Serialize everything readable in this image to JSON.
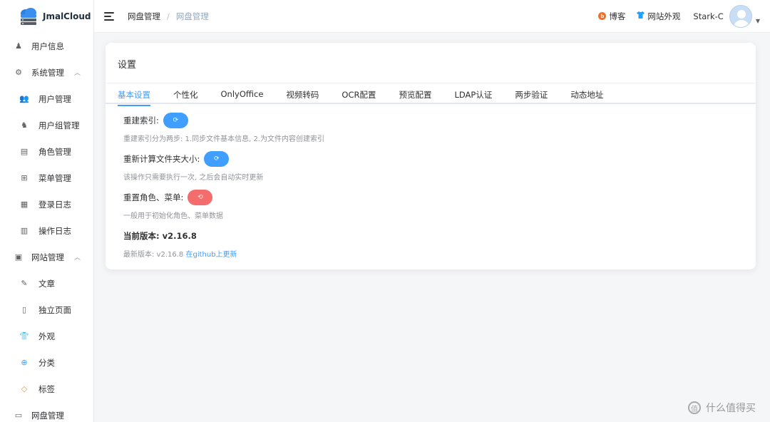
{
  "app": {
    "name": "JmalCloud"
  },
  "sidebar": {
    "items": [
      {
        "label": "用户信息",
        "icon": "user-icon",
        "level": "top"
      },
      {
        "label": "系统管理",
        "icon": "gear-icon",
        "level": "top",
        "expanded": true
      },
      {
        "label": "用户管理",
        "icon": "users-icon",
        "level": "sub"
      },
      {
        "label": "用户组管理",
        "icon": "user-group-icon",
        "level": "sub"
      },
      {
        "label": "角色管理",
        "icon": "id-card-icon",
        "level": "sub"
      },
      {
        "label": "菜单管理",
        "icon": "grid-icon",
        "level": "sub"
      },
      {
        "label": "登录日志",
        "icon": "log-icon",
        "level": "sub"
      },
      {
        "label": "操作日志",
        "icon": "document-icon",
        "level": "sub"
      },
      {
        "label": "网站管理",
        "icon": "monitor-icon",
        "level": "top",
        "expanded": true
      },
      {
        "label": "文章",
        "icon": "article-icon",
        "level": "sub"
      },
      {
        "label": "独立页面",
        "icon": "page-icon",
        "level": "sub"
      },
      {
        "label": "外观",
        "icon": "shirt-icon",
        "level": "sub"
      },
      {
        "label": "分类",
        "icon": "category-icon",
        "level": "sub"
      },
      {
        "label": "标签",
        "icon": "tag-icon",
        "level": "sub"
      },
      {
        "label": "网盘管理",
        "icon": "desktop-icon",
        "level": "top"
      }
    ]
  },
  "header": {
    "breadcrumb": [
      "网盘管理",
      "网盘管理"
    ],
    "separator": "/",
    "blog_label": "博客",
    "appearance_label": "网站外观",
    "username": "Stark-C"
  },
  "main": {
    "title": "设置",
    "tabs": [
      "基本设置",
      "个性化",
      "OnlyOffice",
      "视频转码",
      "OCR配置",
      "预览配置",
      "LDAP认证",
      "两步验证",
      "动态地址"
    ],
    "active_tab": "基本设置",
    "rebuild_index": {
      "label": "重建索引:",
      "hint": "重建索引分为两步: 1.同步文件基本信息, 2.为文件内容创建索引"
    },
    "recalc_size": {
      "label": "重新计算文件夹大小:",
      "hint": "该操作只需要执行一次, 之后会自动实时更新"
    },
    "reset_roles": {
      "label": "重置角色、菜单:",
      "hint": "一般用于初始化角色、菜单数据"
    },
    "current_version_label": "当前版本: v2.16.8",
    "latest_version_prefix": "最新版本: v2.16.8",
    "latest_version_link": "在github上更新"
  },
  "watermark": {
    "text": "什么值得买"
  },
  "colors": {
    "accent": "#409eff",
    "danger": "#f56c6c",
    "blog": "#f56c22"
  }
}
